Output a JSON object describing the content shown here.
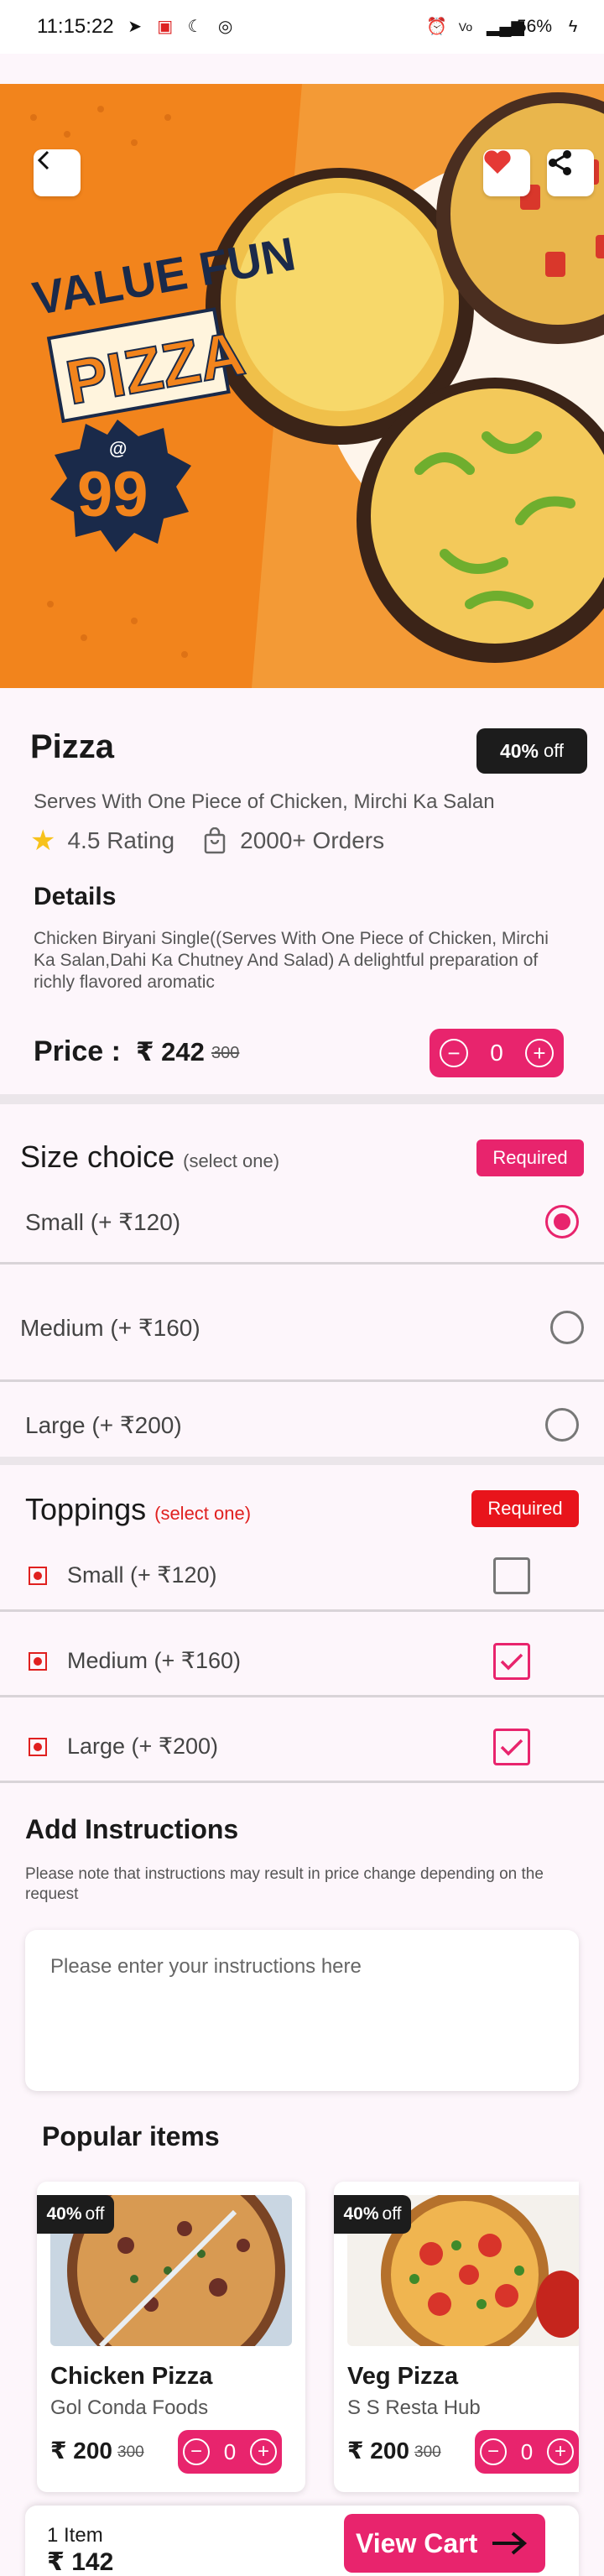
{
  "status_bar": {
    "time": "11:15:22",
    "battery": "56%"
  },
  "product": {
    "title": "Pizza",
    "discount_value": "40%",
    "discount_suffix": "off",
    "serves": "Serves With One Piece of Chicken, Mirchi Ka Salan",
    "rating": "4.5 Rating",
    "orders": "2000+ Orders",
    "details_heading": "Details",
    "details": "Chicken Biryani Single((Serves With One Piece of Chicken, Mirchi Ka Salan,Dahi Ka Chutney And Salad) A delightful preparation of richly flavored aromatic",
    "price_label": "Price :",
    "price": "₹ 242",
    "price_old": "300",
    "quantity": "0"
  },
  "hero_banner": {
    "line1": "VALUE FUN",
    "line2": "PIZZA",
    "at": "@",
    "price": "99"
  },
  "size_choice": {
    "title": "Size choice",
    "subtitle": "(select one)",
    "badge": "Required",
    "badge_color": "#e8246d",
    "options": [
      {
        "label": "Small (+ ₹120)",
        "selected": true
      },
      {
        "label": "Medium (+ ₹160)",
        "selected": false
      },
      {
        "label": "Large (+ ₹200)",
        "selected": false
      }
    ]
  },
  "toppings": {
    "title": "Toppings",
    "subtitle": "(select one)",
    "badge": "Required",
    "badge_color": "#e8141b",
    "options": [
      {
        "label": "Small (+ ₹120)",
        "checked": false
      },
      {
        "label": "Medium (+ ₹160)",
        "checked": true
      },
      {
        "label": "Large (+ ₹200)",
        "checked": true
      }
    ]
  },
  "instructions": {
    "heading": "Add Instructions",
    "note": "Please note that instructions may result in price change depending on the request",
    "placeholder": "Please enter your instructions here"
  },
  "popular": {
    "heading": "Popular items",
    "items": [
      {
        "badge_value": "40%",
        "badge_suffix": "off",
        "name": "Chicken Pizza",
        "shop": "Gol Conda Foods",
        "price": "₹ 200",
        "old_price": "300",
        "quantity": "0",
        "image_icon": "chicken-pizza-image"
      },
      {
        "badge_value": "40%",
        "badge_suffix": "off",
        "name": "Veg Pizza",
        "shop": "S S Resta Hub",
        "price": "₹ 200",
        "old_price": "300",
        "quantity": "0",
        "image_icon": "veg-pizza-image"
      }
    ]
  },
  "cart": {
    "count": "1 Item",
    "total": "₹ 142",
    "button": "View Cart"
  },
  "colors": {
    "accent": "#e8246d",
    "dark_pill": "#1c1c1c",
    "banner_orange": "#f2841c"
  }
}
